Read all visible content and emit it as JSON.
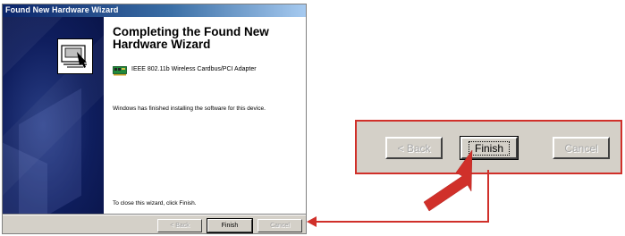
{
  "window": {
    "title": "Found New Hardware Wizard",
    "heading": "Completing the Found New Hardware Wizard",
    "device_name": "IEEE 802.11b Wireless Cardbus/PCI Adapter",
    "finished_message": "Windows has finished installing the software for this device.",
    "close_message": "To close this wizard, click Finish."
  },
  "buttons": {
    "back_label": "< Back",
    "finish_label": "Finish",
    "cancel_label": "Cancel"
  },
  "callout": {
    "back_label": "< Back",
    "finish_label": "Finish",
    "cancel_label": "Cancel"
  },
  "colors": {
    "callout_accent": "#d0302a",
    "titlebar_start": "#0a246a",
    "titlebar_end": "#a6caf0"
  },
  "icons": [
    "wizard-image-icon",
    "network-card-icon",
    "pointer-arrow-icon",
    "connector-arrow-icon"
  ]
}
